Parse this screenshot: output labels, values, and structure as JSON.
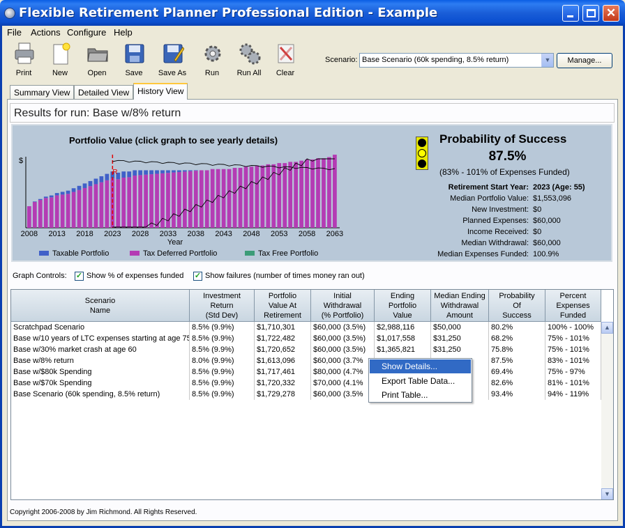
{
  "window": {
    "title": "Flexible Retirement Planner Professional Edition - Example"
  },
  "menu": [
    "File",
    "Actions",
    "Configure",
    "Help"
  ],
  "toolbar": {
    "buttons": [
      {
        "label": "Print",
        "icon": "printer-icon"
      },
      {
        "label": "New",
        "icon": "new-document-icon"
      },
      {
        "label": "Open",
        "icon": "open-folder-icon"
      },
      {
        "label": "Save",
        "icon": "floppy-disk-icon"
      },
      {
        "label": "Save As",
        "icon": "save-as-icon"
      },
      {
        "label": "Run",
        "icon": "gear-icon"
      },
      {
        "label": "Run All",
        "icon": "gears-icon"
      },
      {
        "label": "Clear",
        "icon": "clear-icon"
      }
    ],
    "scenario_label": "Scenario:",
    "scenario_value": "Base Scenario (60k spending, 8.5% return)",
    "manage_label": "Manage..."
  },
  "tabs": [
    {
      "label": "Summary View",
      "active": false
    },
    {
      "label": "Detailed View",
      "active": false
    },
    {
      "label": "History View",
      "active": true
    }
  ],
  "results_label": "Results for run:  Base w/8% return",
  "chart": {
    "title": "Portfolio Value  (click graph to see yearly details)",
    "y_symbol": "$",
    "retirement_marker": "R",
    "xlabel": "Year",
    "legend": [
      {
        "name": "Taxable Portfolio",
        "color": "#4060c8"
      },
      {
        "name": "Tax Deferred Portfolio",
        "color": "#b43cb4"
      },
      {
        "name": "Tax Free Portfolio",
        "color": "#3c9c78"
      }
    ]
  },
  "chart_data": {
    "type": "bar",
    "xlabel": "Year",
    "xticks": [
      "2008",
      "2013",
      "2018",
      "2023",
      "2028",
      "2033",
      "2038",
      "2043",
      "2048",
      "2053",
      "2058",
      "2063"
    ],
    "x_start": 2008,
    "retirement_year": 2023,
    "taxable": [
      0.0,
      0.38,
      0.77,
      1.15,
      1.54,
      1.92,
      2.31,
      2.69,
      3.08,
      3.46,
      3.85,
      4.23,
      4.62,
      5.0,
      5.38,
      5.77,
      5.5,
      5.13,
      4.77,
      4.4,
      4.03,
      3.67,
      3.3,
      2.93,
      2.57,
      2.2,
      1.83,
      1.47,
      1.1,
      0.73,
      0.37,
      0.0,
      0,
      0,
      0,
      0,
      0,
      0,
      0,
      0,
      0,
      0,
      0,
      0,
      0,
      0,
      0,
      0,
      0,
      0,
      0,
      0,
      0,
      0,
      0,
      0
    ],
    "total": [
      18,
      22,
      24,
      26,
      27,
      29,
      30,
      31,
      33,
      35,
      37,
      39,
      41,
      43,
      45,
      47,
      46,
      47,
      47,
      48,
      48,
      48,
      48,
      48,
      48,
      48,
      48,
      48,
      48,
      48,
      48,
      48,
      48,
      49,
      49,
      49,
      49,
      50,
      50,
      51,
      51,
      52,
      52,
      53,
      53,
      54,
      54,
      55,
      55,
      56,
      57,
      57,
      58,
      58,
      59,
      61
    ],
    "pct_expenses_funded_line": "thin black line showing % of expenses funded per year (values not labeled)",
    "failures_line": "thin black line showing number of failures per year (values not labeled)"
  },
  "probability": {
    "title": "Probability of Success",
    "value": "87.5%",
    "range": "(83% - 101% of Expenses Funded)",
    "stats": [
      {
        "key": "Retirement Start Year:",
        "value": "2023 (Age: 55)",
        "bold": true
      },
      {
        "key": "Median Portfolio Value:",
        "value": "$1,553,096"
      },
      {
        "key": "New Investment:",
        "value": "$0"
      },
      {
        "key": "Planned Expenses:",
        "value": "$60,000"
      },
      {
        "key": "Income Received:",
        "value": "$0"
      },
      {
        "key": "Median Withdrawal:",
        "value": "$60,000"
      },
      {
        "key": "Median Expenses Funded:",
        "value": "100.9%"
      }
    ],
    "traffic_light": "yellow"
  },
  "graph_controls": {
    "label": "Graph Controls:",
    "show_pct": "Show % of expenses funded",
    "show_failures": "Show failures (number of times money ran out)"
  },
  "table": {
    "headers": [
      [
        "Scenario",
        "Name"
      ],
      [
        "Investment",
        "Return",
        "(Std Dev)"
      ],
      [
        "Portfolio",
        "Value At",
        "Retirement"
      ],
      [
        "Initial",
        "Withdrawal",
        "(% Portfolio)"
      ],
      [
        "Ending",
        "Portfolio",
        "Value"
      ],
      [
        "Median Ending",
        "Withdrawal",
        "Amount"
      ],
      [
        "Probability",
        "Of",
        "Success"
      ],
      [
        "Percent",
        "Expenses",
        "Funded"
      ]
    ],
    "rows": [
      [
        "Scratchpad Scenario",
        "8.5% (9.9%)",
        "$1,710,301",
        "$60,000 (3.5%)",
        "$2,988,116",
        "$50,000",
        "80.2%",
        "100% - 100%"
      ],
      [
        "Base w/10 years of LTC expenses starting at age 75",
        "8.5% (9.9%)",
        "$1,722,482",
        "$60,000 (3.5%)",
        "$1,017,558",
        "$31,250",
        "68.2%",
        "75% - 101%"
      ],
      [
        "Base w/30% market crash at age 60",
        "8.5% (9.9%)",
        "$1,720,652",
        "$60,000 (3.5%)",
        "$1,365,821",
        "$31,250",
        "75.8%",
        "75% - 101%"
      ],
      [
        "Base w/8% return",
        "8.0% (9.9%)",
        "$1,613,096",
        "$60,000 (3.7%",
        "",
        "",
        "87.5%",
        "83% - 101%"
      ],
      [
        "Base w/$80k Spending",
        "8.5% (9.9%)",
        "$1,717,461",
        "$80,000 (4.7%",
        "",
        "",
        "69.4%",
        "75% - 97%"
      ],
      [
        "Base w/$70k Spending",
        "8.5% (9.9%)",
        "$1,720,332",
        "$70,000 (4.1%",
        "",
        "",
        "82.6%",
        "81% - 101%"
      ],
      [
        "Base Scenario (60k spending, 8.5% return)",
        "8.5% (9.9%)",
        "$1,729,278",
        "$60,000 (3.5%",
        "",
        "",
        "93.4%",
        "94% - 119%"
      ]
    ]
  },
  "context_menu": [
    "Show Details...",
    "Export Table Data...",
    "Print Table..."
  ],
  "copyright": "Copyright 2006-2008 by Jim Richmond.  All Rights Reserved."
}
